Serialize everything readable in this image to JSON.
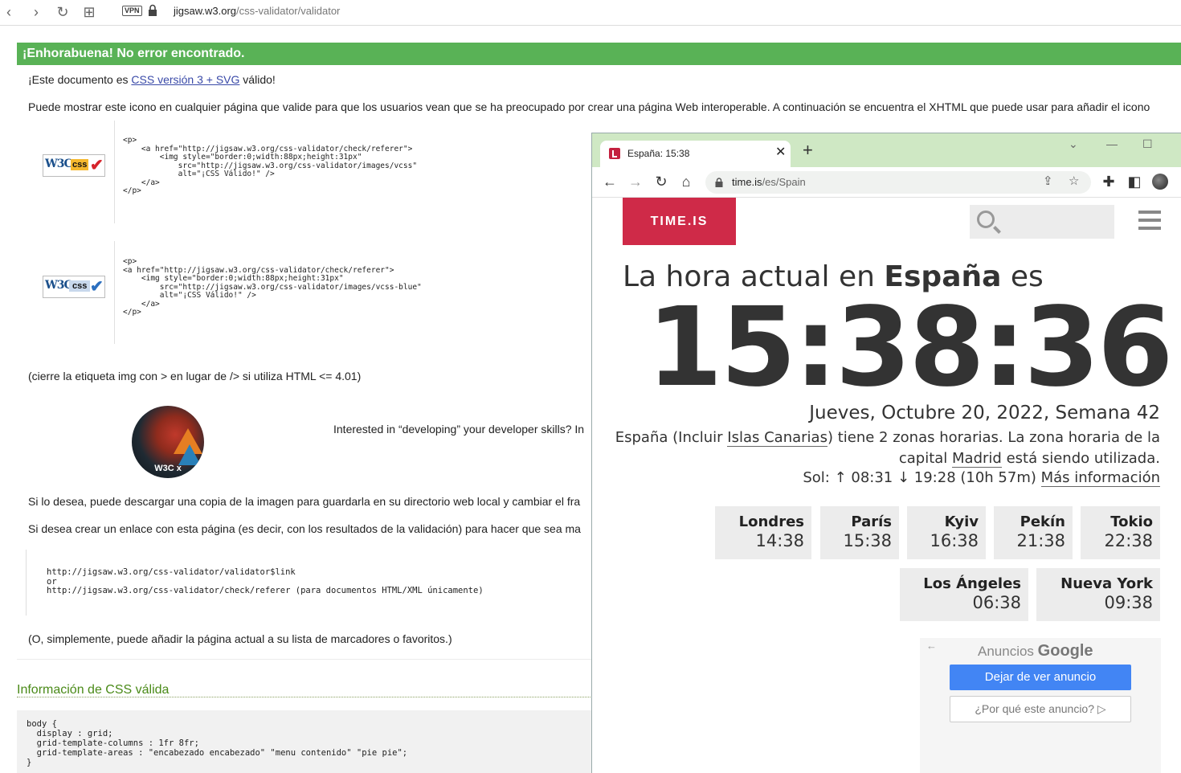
{
  "browser": {
    "url_prefix": "jigsaw.w3.org",
    "url_path": "/css-validator/validator",
    "vpn_label": "VPN",
    "nav": {
      "back": "‹",
      "forward": "›",
      "reload": "↻",
      "tabs": "⊞"
    }
  },
  "validator": {
    "success_banner": "¡Enhorabuena! No error encontrado.",
    "valid_prefix": "¡Este documento es ",
    "valid_link": "CSS versión 3 + SVG",
    "valid_suffix": " válido!",
    "icon_intro": "Puede mostrar este icono en cualquier página que valide para que los usuarios vean que se ha preocupado por crear una página Web interoperable. A continuación se encuentra el XHTML que puede usar para añadir el icono",
    "badge1": {
      "w3c": "W3C",
      "css": "css",
      "check": "✔",
      "check_color": "#d6232b"
    },
    "badge2": {
      "w3c": "W3C",
      "css": "css",
      "check": "✔",
      "check_color": "#2c6fbf"
    },
    "snippet1": "<p>\n    <a href=\"http://jigsaw.w3.org/css-validator/check/referer\">\n        <img style=\"border:0;width:88px;height:31px\"\n            src=\"http://jigsaw.w3.org/css-validator/images/vcss\"\n            alt=\"¡CSS Válido!\" />\n    </a>\n</p>",
    "snippet2": "<p>\n<a href=\"http://jigsaw.w3.org/css-validator/check/referer\">\n    <img style=\"border:0;width:88px;height:31px\"\n        src=\"http://jigsaw.w3.org/css-validator/images/vcss-blue\"\n        alt=\"¡CSS Válido!\" />\n    </a>\n</p>",
    "close_img_note": "(cierre la etiqueta img con > en lugar de /> si utiliza HTML <= 4.01)",
    "promo_logo_label": "W3C x",
    "promo_text": "Interested in “developing” your developer skills? In",
    "download_text": "Si lo desea, puede descargar una copia de la imagen para guardarla en su directorio web local y cambiar el fra",
    "link_text": "Si desea crear un enlace con esta página (es decir, con los resultados de la validación) para hacer que sea ma",
    "links_block": "http://jigsaw.w3.org/css-validator/validator$link\nor\nhttp://jigsaw.w3.org/css-validator/check/referer (para documentos HTML/XML únicamente)",
    "bookmark_text": "(O, simplemente, puede añadir la página actual a su lista de marcadores o favoritos.)",
    "info_heading": "Información de CSS válida",
    "css_code": "body {\n  display : grid;\n  grid-template-columns : 1fr 8fr;\n  grid-template-areas : \"encabezado encabezado\" \"menu contenido\" \"pie pie\";\n}"
  },
  "overlay": {
    "tab_title": "España: 15:38",
    "tab_close": "✕",
    "new_tab": "+",
    "omni_host": "time.is",
    "omni_path": "/es/Spain",
    "controls": {
      "chevron": "⌄",
      "minimize": "—",
      "maximize": "☐"
    },
    "site_logo": "TIME.IS",
    "heading_pre": "La hora actual en ",
    "heading_country": "España",
    "heading_post": " es",
    "clock": "15:38:36",
    "date": "Jueves, Octubre 20, 2022, Semana 42",
    "tz_pre": "España (Incluir ",
    "tz_link1": "Islas Canarias",
    "tz_mid": ") tiene 2 zonas horarias. La zona horaria de la capital ",
    "tz_link2": "Madrid",
    "tz_post": " está siendo utilizada.",
    "sun_text": "Sol: ↑ 08:31 ↓ 19:28 (10h 57m) ",
    "sun_link": "Más información",
    "cities": [
      {
        "name": "Londres",
        "time": "14:38"
      },
      {
        "name": "París",
        "time": "15:38"
      },
      {
        "name": "Kyiv",
        "time": "16:38"
      },
      {
        "name": "Pekín",
        "time": "21:38"
      },
      {
        "name": "Tokio",
        "time": "22:38"
      },
      {
        "name": "Los Ángeles",
        "time": "06:38"
      },
      {
        "name": "Nueva York",
        "time": "09:38"
      }
    ],
    "ads": {
      "back": "←",
      "header_pre": "Anuncios ",
      "header_brand": "Google",
      "stop_button": "Dejar de ver anuncio",
      "why_button": "¿Por qué este anuncio? ▷"
    }
  },
  "colors": {
    "success_green": "#59b256",
    "time_is_red": "#cf2a48",
    "tab_strip_green": "#cfe8c4",
    "ad_blue": "#4285f4"
  }
}
